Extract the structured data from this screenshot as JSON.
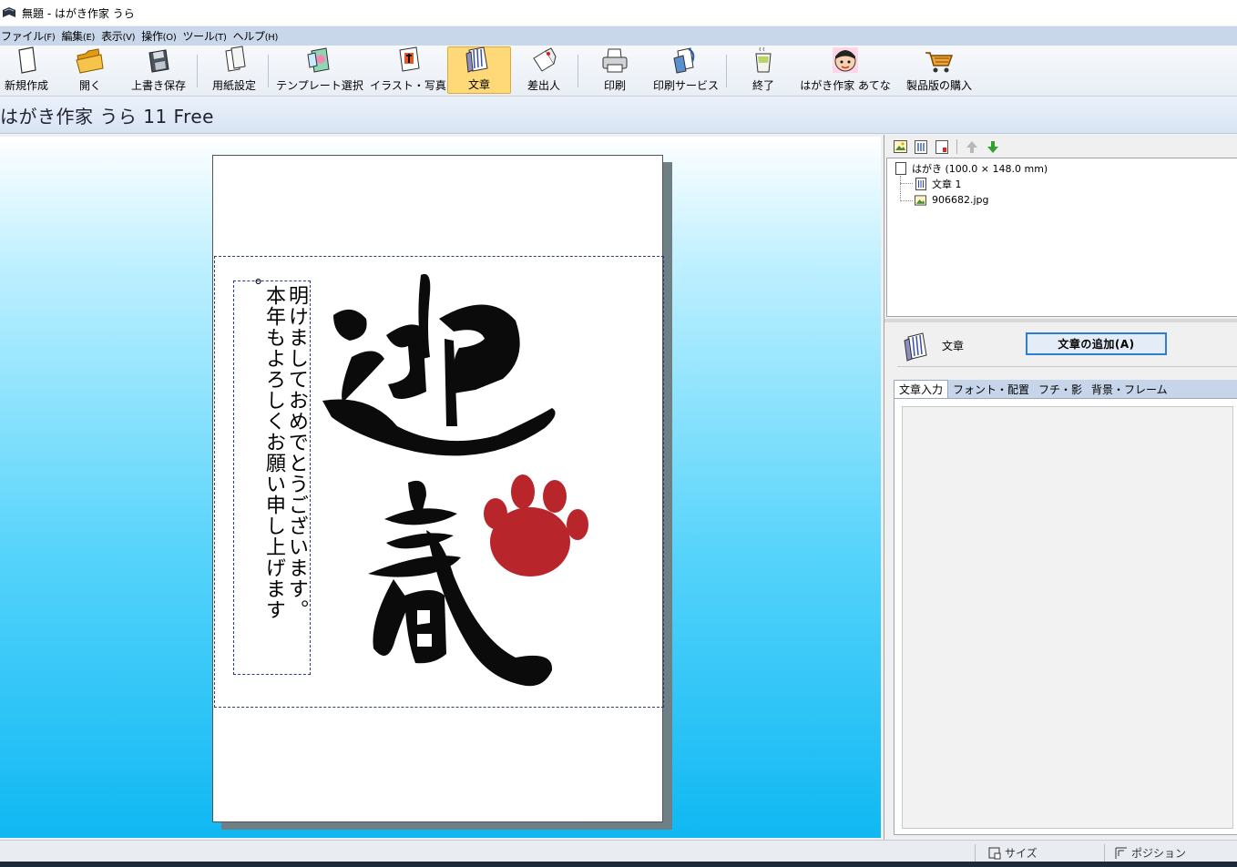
{
  "window": {
    "title": "無題 - はがき作家 うら"
  },
  "menu": [
    {
      "label": "ファイル",
      "key": "(F)"
    },
    {
      "label": "編集",
      "key": "(E)"
    },
    {
      "label": "表示",
      "key": "(V)"
    },
    {
      "label": "操作",
      "key": "(O)"
    },
    {
      "label": "ツール",
      "key": "(T)"
    },
    {
      "label": "ヘルプ",
      "key": "(H)"
    }
  ],
  "toolbar": {
    "new": "新規作成",
    "open": "開く",
    "save": "上書き保存",
    "paper": "用紙設定",
    "template": "テンプレート選択",
    "illust": "イラスト・写真",
    "text": "文章",
    "sender": "差出人",
    "print": "印刷",
    "print_service": "印刷サービス",
    "exit": "終了",
    "atena": "はがき作家 あてな",
    "buy": "製品版の購入"
  },
  "header": {
    "title": "はがき作家 うら 11 Free"
  },
  "card": {
    "text_lines": [
      "明けましておめでとうございます。",
      "本年もよろしくお願い申し上げます",
      "。"
    ],
    "image_text": "迎春",
    "paw_color": "#b8262c"
  },
  "tree": {
    "root": "はがき (100.0 × 148.0 mm)",
    "items": [
      "文章 1",
      "906682.jpg"
    ]
  },
  "props": {
    "section_label": "文章",
    "add_button": "文章の追加(A)",
    "tabs": [
      "文章入力",
      "フォント・配置",
      "フチ・影",
      "背景・フレーム"
    ]
  },
  "status": {
    "size_label": "サイズ",
    "position_label": "ポジション"
  }
}
